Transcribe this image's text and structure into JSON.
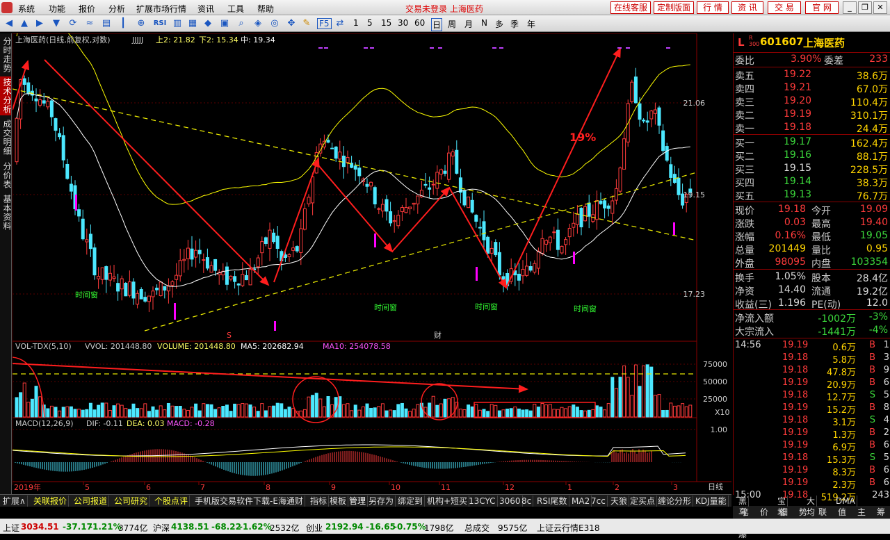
{
  "menubar": {
    "items": [
      "系统",
      "功能",
      "报价",
      "分析",
      "扩展市场行情",
      "资讯",
      "工具",
      "帮助"
    ],
    "center_title": "交易未登录  上海医药",
    "right_buttons": [
      "在线客服",
      "定制版面",
      "行 情",
      "资 讯",
      "交 易",
      "官 网"
    ]
  },
  "toolbar": {
    "periods": [
      "1",
      "5",
      "15",
      "30",
      "60"
    ],
    "cycles": [
      "日",
      "周",
      "月",
      "N",
      "多",
      "季",
      "年"
    ],
    "f5": "F5"
  },
  "sidetabs": [
    "分时走势",
    "技术分析",
    "成交明细",
    "分价表",
    "基本资料"
  ],
  "main": {
    "title": "上海医药(日线,前复权,对数)",
    "indicator": "JJJJJ",
    "up2": "上2: 21.82",
    "down2": "下2: 15.34",
    "mid": "中: 19.34",
    "price_ticks": [
      "21.06",
      "19.15",
      "17.23"
    ],
    "annotation_pct": "19%",
    "window_labels": [
      "时间窗",
      "时间窗",
      "时间窗",
      "时间窗"
    ],
    "marker_s": "S",
    "marker_cai": "财"
  },
  "vol": {
    "name": "VOL-TDX(5,10)",
    "vvol": "VVOL: 201448.80",
    "volume": "VOLUME: 201448.80",
    "ma5": "MA5: 202682.94",
    "ma10": "MA10: 254078.58",
    "ticks": [
      "75000",
      "50000",
      "25000"
    ],
    "unit": "X10"
  },
  "macd": {
    "name": "MACD(12,26,9)",
    "dif": "DIF: -0.11",
    "dea": "DEA: 0.03",
    "macd": "MACD: -0.28",
    "tick": "1.00"
  },
  "xaxis": {
    "labels": [
      "2019年",
      "5",
      "6",
      "7",
      "8",
      "9",
      "10",
      "11",
      "12",
      "1",
      "2",
      "3"
    ],
    "period": "日线"
  },
  "quote": {
    "code": "601607",
    "name": "上海医药",
    "weibi_label": "委比",
    "weibi": "3.90%",
    "weicha_label": "委差",
    "weicha": "233",
    "asks": [
      {
        "label": "卖五",
        "price": "19.22",
        "vol": "38.6万"
      },
      {
        "label": "卖四",
        "price": "19.21",
        "vol": "67.0万"
      },
      {
        "label": "卖三",
        "price": "19.20",
        "vol": "110.4万"
      },
      {
        "label": "卖二",
        "price": "19.19",
        "vol": "310.1万"
      },
      {
        "label": "卖一",
        "price": "19.18",
        "vol": "24.4万"
      }
    ],
    "bids": [
      {
        "label": "买一",
        "price": "19.17",
        "vol": "162.4万"
      },
      {
        "label": "买二",
        "price": "19.16",
        "vol": "88.1万"
      },
      {
        "label": "买三",
        "price": "19.15",
        "vol": "228.5万"
      },
      {
        "label": "买四",
        "price": "19.14",
        "vol": "38.3万"
      },
      {
        "label": "买五",
        "price": "19.13",
        "vol": "76.7万"
      }
    ],
    "stats": [
      {
        "l1": "现价",
        "v1": "19.18",
        "l2": "今开",
        "v2": "19.09"
      },
      {
        "l1": "涨跌",
        "v1": "0.03",
        "l2": "最高",
        "v2": "19.40"
      },
      {
        "l1": "涨幅",
        "v1": "0.16%",
        "l2": "最低",
        "v2": "19.05"
      },
      {
        "l1": "总量",
        "v1": "201449",
        "l2": "量比",
        "v2": "0.95"
      },
      {
        "l1": "外盘",
        "v1": "98095",
        "l2": "内盘",
        "v2": "103354"
      }
    ],
    "fund": [
      {
        "l1": "换手",
        "v1": "1.05%",
        "l2": "股本",
        "v2": "28.4亿"
      },
      {
        "l1": "净资",
        "v1": "14.40",
        "l2": "流通",
        "v2": "19.2亿"
      },
      {
        "l1": "收益(三)",
        "v1": "1.196",
        "l2": "PE(动)",
        "v2": "12.0"
      }
    ],
    "flows": [
      {
        "label": "净流入额",
        "value": "-1002万",
        "pct": "-3%"
      },
      {
        "label": "大宗流入",
        "value": "-1441万",
        "pct": "-4%"
      }
    ],
    "ticks": [
      {
        "time": "14:56",
        "price": "19.19",
        "vol": "0.6万",
        "side": "B",
        "n": "1"
      },
      {
        "time": "",
        "price": "19.18",
        "vol": "5.8万",
        "side": "B",
        "n": "3"
      },
      {
        "time": "",
        "price": "19.18",
        "vol": "47.8万",
        "side": "B",
        "n": "9"
      },
      {
        "time": "",
        "price": "19.19",
        "vol": "20.9万",
        "side": "B",
        "n": "6"
      },
      {
        "time": "",
        "price": "19.18",
        "vol": "12.7万",
        "side": "S",
        "n": "5"
      },
      {
        "time": "",
        "price": "19.19",
        "vol": "15.2万",
        "side": "B",
        "n": "8"
      },
      {
        "time": "",
        "price": "19.18",
        "vol": "3.1万",
        "side": "S",
        "n": "4"
      },
      {
        "time": "",
        "price": "19.19",
        "vol": "1.3万",
        "side": "B",
        "n": "2"
      },
      {
        "time": "",
        "price": "19.19",
        "vol": "6.9万",
        "side": "B",
        "n": "6"
      },
      {
        "time": "",
        "price": "19.18",
        "vol": "15.3万",
        "side": "S",
        "n": "5"
      },
      {
        "time": "",
        "price": "19.19",
        "vol": "8.3万",
        "side": "B",
        "n": "6"
      },
      {
        "time": "",
        "price": "19.19",
        "vol": "2.3万",
        "side": "B",
        "n": "6"
      },
      {
        "time": "15:00",
        "price": "19.18",
        "vol": "519.2万",
        "side": "",
        "n": "243"
      }
    ],
    "bottom_tabs": [
      "笔",
      "价",
      "细",
      "势",
      "联",
      "值",
      "主",
      "筹"
    ]
  },
  "bottom_tabs": [
    "扩展∧",
    "关联报价",
    "公司报道",
    "公司研究",
    "个股点评",
    "手机版交易软件下载-E海通财",
    "指标",
    "模板",
    "管理",
    "另存为",
    "绑定到",
    "机构+短买",
    "13CYC",
    "3060",
    "8c",
    "RSI尾数",
    "MA2",
    "7cc",
    "天狼",
    "定买点",
    "缠论分形",
    "KDJ量能",
    "黑马启爆",
    "宝塔线",
    "大均线",
    "DMA"
  ],
  "statusbar": {
    "sh_label": "上证",
    "sh_val": "3034.51",
    "sh_chg": "-37.17",
    "sh_pct": "-1.21%",
    "sh_amt": "3774亿",
    "hs_label": "沪深",
    "hs_val": "4138.51",
    "hs_chg": "-68.22",
    "hs_pct": "-1.62%",
    "hs_amt": "2532亿",
    "cy_label": "创业",
    "cy_val": "2192.94",
    "cy_chg": "-16.65",
    "cy_pct": "-0.75%",
    "cy_amt": "1798亿",
    "total_label": "总成交",
    "total_val": "9575亿",
    "cloud": "上证云行情E318"
  },
  "chart_data": {
    "type": "candlestick",
    "title": "上海医药(日线,前复权,对数)",
    "price_axis": {
      "ticks": [
        21.06,
        19.15,
        17.23
      ]
    },
    "overlay_levels": {
      "上2": 21.82,
      "下2": 15.34,
      "中": 19.34
    },
    "volume_axis": {
      "ticks": [
        75000,
        50000,
        25000
      ]
    },
    "macd_axis": {
      "ticks": [
        1.0
      ]
    },
    "x_labels": [
      "2019年",
      "5",
      "6",
      "7",
      "8",
      "9",
      "10",
      "11",
      "12",
      "1",
      "2",
      "3"
    ],
    "last": {
      "VOLUME": 201448.8,
      "MA5": 202682.94,
      "MA10": 254078.58,
      "DIF": -0.11,
      "DEA": 0.03,
      "MACD": -0.28
    }
  },
  "colors": {
    "up": "#ff3b3b",
    "down": "#4ce8ff",
    "ma_white": "#ffffff",
    "ma_yellow": "#ffff00",
    "trend_red": "#ff1e1e",
    "dash": "#e6e600",
    "macd_marker": "#ff00ff"
  }
}
